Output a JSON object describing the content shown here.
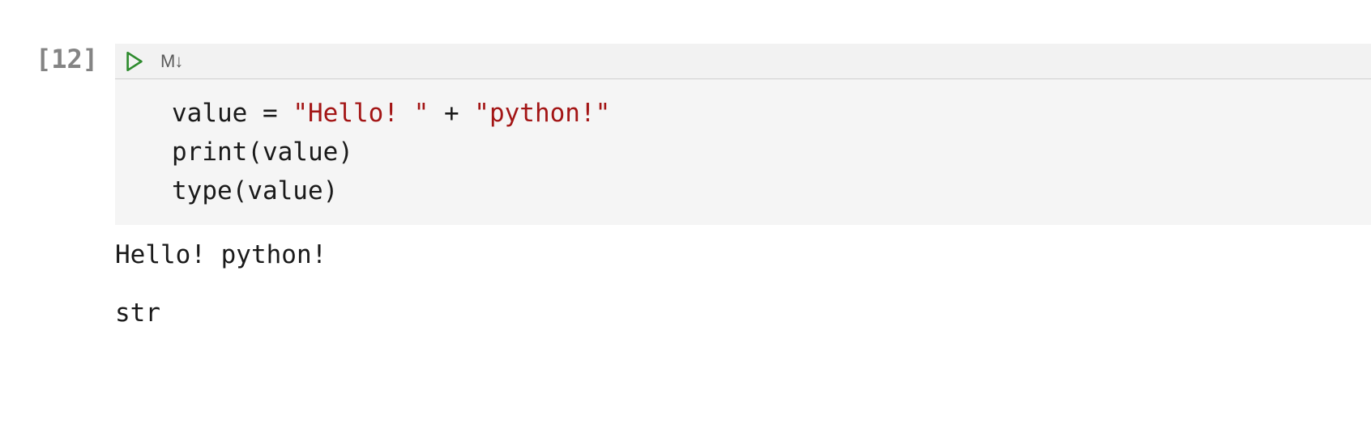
{
  "cell": {
    "execution_count": "[12]",
    "toolbar": {
      "markdown_label": "M↓"
    },
    "code": {
      "line1_var": "value ",
      "line1_op": "= ",
      "line1_str1": "\"Hello! \"",
      "line1_plus": " + ",
      "line1_str2": "\"python!\"",
      "line2": "print(value)",
      "line3": "type(value)"
    },
    "output": {
      "stdout": "Hello! python!",
      "result": "str"
    }
  }
}
